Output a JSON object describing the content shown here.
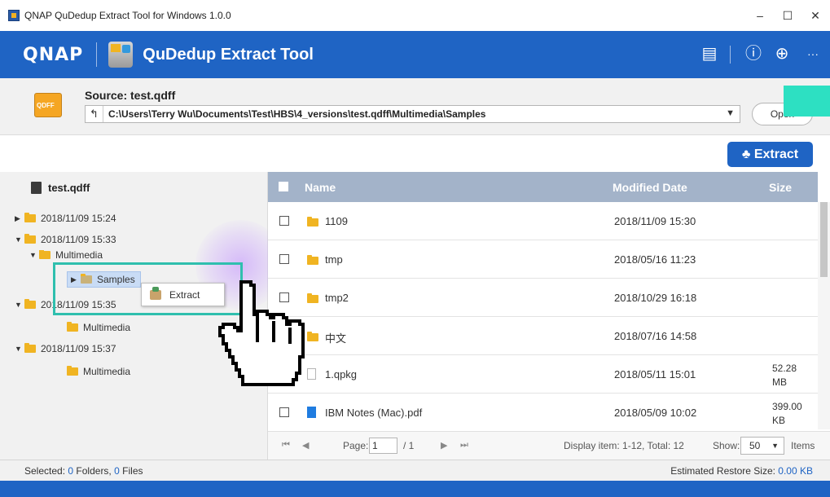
{
  "window": {
    "title": "QNAP QuDedup Extract Tool for Windows 1.0.0",
    "controls": [
      "–",
      "☐",
      "✕"
    ]
  },
  "header": {
    "logo": "QNAP",
    "app_title": "QuDedup Extract Tool",
    "icons": [
      "clipboard-icon",
      "info-icon",
      "globe-icon",
      "more-icon"
    ],
    "icon_glyphs": [
      "▤",
      "ⓘ",
      "⊕",
      "···"
    ]
  },
  "source": {
    "label": "Source: test.qdff",
    "icon_text": "QDFF",
    "path": "C:\\Users\\Terry Wu\\Documents\\Test\\HBS\\4_versions\\test.qdff\\Multimedia\\Samples",
    "open_label": "Open"
  },
  "toolbar": {
    "extract_label": "Extract"
  },
  "tree": {
    "root": "test.qdff",
    "nodes": [
      {
        "label": "2018/11/09 15:24",
        "arrow": "▶"
      },
      {
        "label": "2018/11/09 15:33",
        "arrow": "▼"
      },
      {
        "label": "Multimedia",
        "arrow": "▼"
      },
      {
        "label": "Samples",
        "arrow": "▶"
      },
      {
        "label": "2018/11/09 15:35",
        "arrow": "▼"
      },
      {
        "label": "Multimedia",
        "arrow": ""
      },
      {
        "label": "2018/11/09 15:37",
        "arrow": "▼"
      },
      {
        "label": "Multimedia",
        "arrow": ""
      }
    ],
    "context_menu": {
      "item": "Extract"
    }
  },
  "list": {
    "columns": {
      "name": "Name",
      "date": "Modified Date",
      "size": "Size"
    },
    "rows": [
      {
        "name": "1109",
        "date": "2018/11/09 15:30",
        "size": "",
        "type": "folder"
      },
      {
        "name": "tmp",
        "date": "2018/05/16 11:23",
        "size": "",
        "type": "folder"
      },
      {
        "name": "tmp2",
        "date": "2018/10/29 16:18",
        "size": "",
        "type": "folder"
      },
      {
        "name": "中文",
        "date": "2018/07/16 14:58",
        "size": "",
        "type": "folder"
      },
      {
        "name": "1.qpkg",
        "date": "2018/05/11 15:01",
        "size": "52.28 MB",
        "type": "file"
      },
      {
        "name": "IBM Notes (Mac).pdf",
        "date": "2018/05/09 10:02",
        "size": "399.00 KB",
        "type": "pdf"
      }
    ]
  },
  "pager": {
    "page_label": "Page:",
    "page_value": "1",
    "total_pages": "/ 1",
    "display": "Display item: 1-12, Total: 12",
    "show_label": "Show:",
    "show_value": "50",
    "items_label": "Items"
  },
  "status": {
    "selected_prefix": "Selected:",
    "folders_count": "0",
    "folders_label": "Folders,",
    "files_count": "0",
    "files_label": "Files",
    "restore_label": "Estimated Restore Size:",
    "restore_value": "0.00 KB"
  },
  "colors": {
    "brand_blue": "#1f64c4",
    "header_gray": "#a3b3c9",
    "highlight_teal": "#2fbfae",
    "folder_yellow": "#f0b422"
  }
}
